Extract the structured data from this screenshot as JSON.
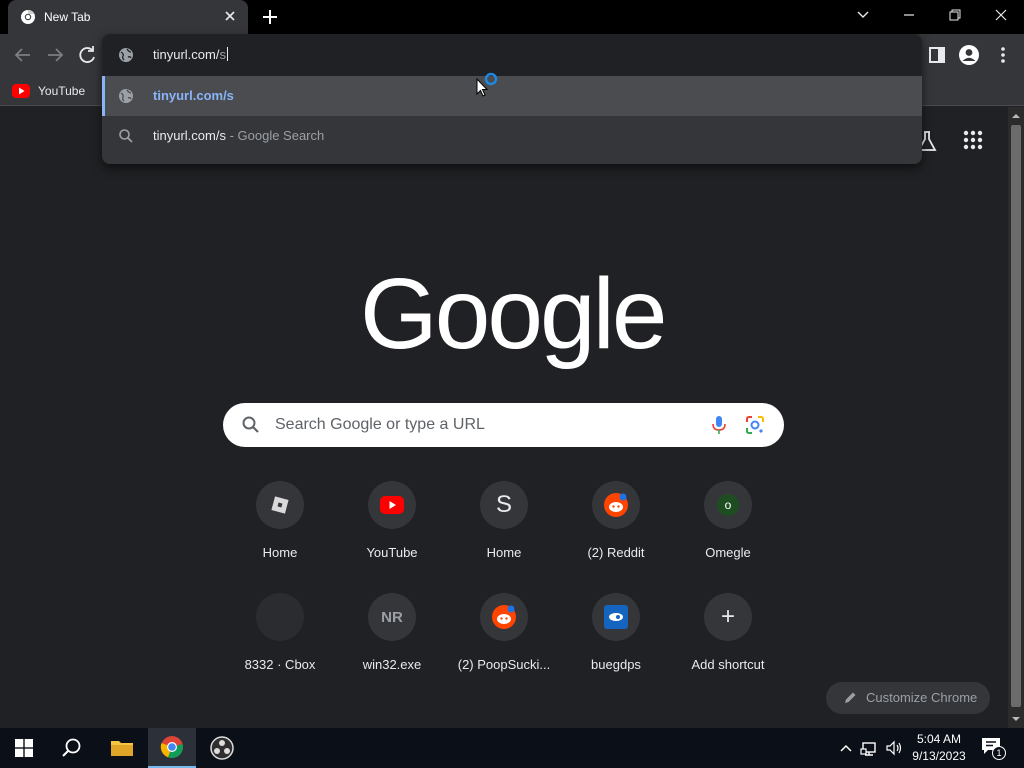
{
  "tab": {
    "title": "New Tab"
  },
  "omnibox": {
    "typed_prefix": "tinyurl.com/",
    "typed_suffix": "s",
    "suggestions": [
      {
        "text": "tinyurl.com/s",
        "secondary": ""
      },
      {
        "text": "tinyurl.com/s",
        "secondary": " - Google Search"
      }
    ]
  },
  "bookmarks": [
    {
      "label": "YouTube"
    }
  ],
  "ntp": {
    "logo": "Google",
    "search_placeholder": "Search Google or type a URL",
    "shortcuts": [
      {
        "label": "Home",
        "glyph": ""
      },
      {
        "label": "YouTube",
        "glyph": ""
      },
      {
        "label": "Home",
        "glyph": "S"
      },
      {
        "label": "(2) Reddit",
        "glyph": ""
      },
      {
        "label": "Omegle",
        "glyph": "o"
      },
      {
        "label": "8332 · Cbox",
        "glyph": ""
      },
      {
        "label": "win32.exe",
        "glyph": "NR"
      },
      {
        "label": "(2) PoopSucki...",
        "glyph": ""
      },
      {
        "label": "buegdps",
        "glyph": ""
      },
      {
        "label": "Add shortcut",
        "glyph": "+"
      }
    ],
    "customize_label": "Customize Chrome"
  },
  "taskbar": {
    "time": "5:04 AM",
    "date": "9/13/2023",
    "notification_count": "1"
  },
  "colors": {
    "accent_blue": "#8ab4f8",
    "youtube_red": "#ff0000",
    "reddit_orange": "#ff4500",
    "bg": "#202124"
  }
}
